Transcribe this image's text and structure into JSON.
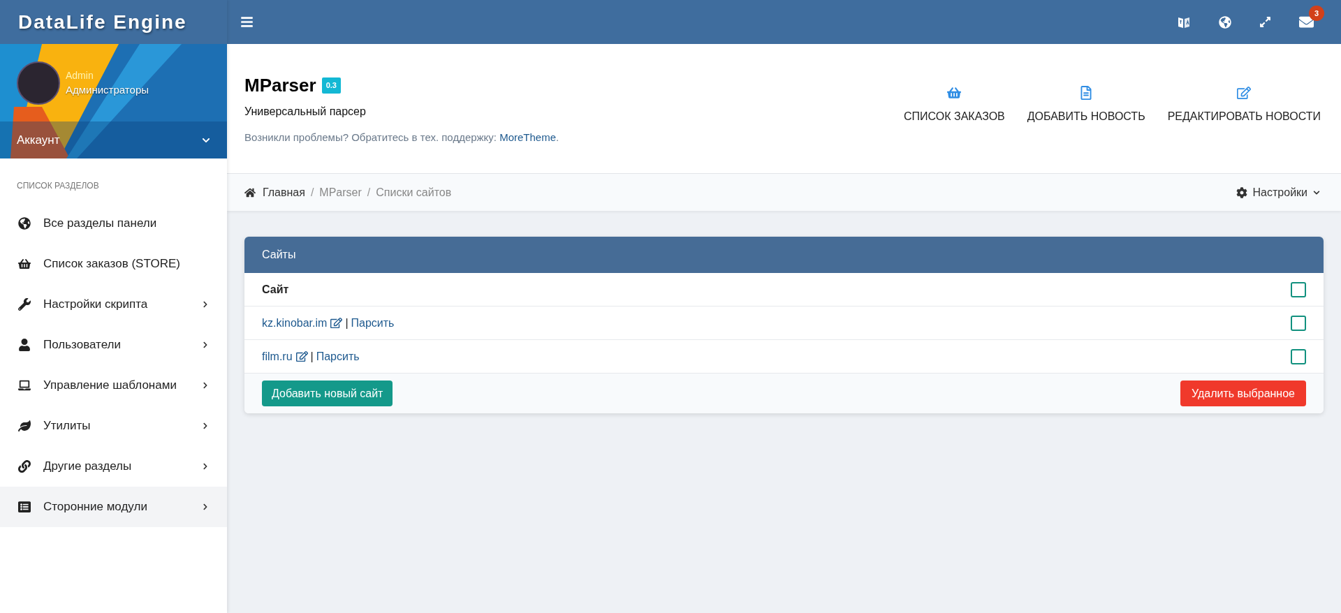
{
  "topbar": {
    "brand": "DataLife Engine",
    "notifications_badge": "3"
  },
  "user": {
    "name": "Admin",
    "group": "Администраторы",
    "account_label": "Аккаунт"
  },
  "sidebar": {
    "heading": "СПИСОК РАЗДЕЛОВ",
    "items": [
      {
        "label": "Все разделы панели",
        "has_submenu": false,
        "selected": false
      },
      {
        "label": "Список заказов (STORE)",
        "has_submenu": false,
        "selected": false
      },
      {
        "label": "Настройки скрипта",
        "has_submenu": true,
        "selected": false
      },
      {
        "label": "Пользователи",
        "has_submenu": true,
        "selected": false
      },
      {
        "label": "Управление шаблонами",
        "has_submenu": true,
        "selected": false
      },
      {
        "label": "Утилиты",
        "has_submenu": true,
        "selected": false
      },
      {
        "label": "Другие разделы",
        "has_submenu": true,
        "selected": false
      },
      {
        "label": "Сторонние модули",
        "has_submenu": true,
        "selected": true
      }
    ]
  },
  "header": {
    "title": "MParser",
    "version": "0.3",
    "subtitle": "Универсальный парсер",
    "support_text": "Возникли проблемы? Обратитесь в тех. поддержку:",
    "support_link": "MoreTheme",
    "support_end": ".",
    "actions": [
      "СПИСОК ЗАКАЗОВ",
      "ДОБАВИТЬ НОВОСТЬ",
      "РЕДАКТИРОВАТЬ НОВОСТИ"
    ]
  },
  "breadcrumb": {
    "items": [
      "Главная",
      "MParser",
      "Списки сайтов"
    ],
    "separators": [
      "/",
      "/"
    ],
    "settings": "Настройки"
  },
  "panel": {
    "title": "Сайты",
    "column": "Сайт",
    "header_checked": false,
    "rows": [
      {
        "site": "kz.kinobar.im",
        "separator": "|",
        "action": "Парсить",
        "checked": false
      },
      {
        "site": "film.ru",
        "separator": "|",
        "action": "Парсить",
        "checked": false
      }
    ],
    "add_button": "Добавить новый сайт",
    "delete_button": "Удалить выбранное"
  }
}
